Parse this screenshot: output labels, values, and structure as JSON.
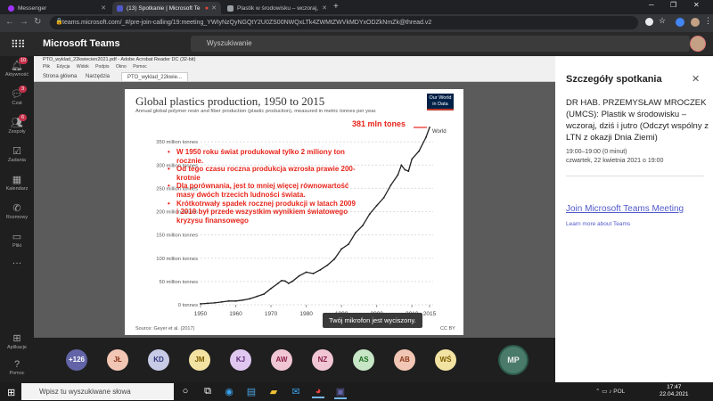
{
  "browser": {
    "tabs": [
      {
        "title": "Messenger",
        "icon": "messenger-icon",
        "color": "#a033ff"
      },
      {
        "title": "(13) Spotkanie | Microsoft Te",
        "icon": "teams-icon",
        "color": "#5059c9"
      },
      {
        "title": "Plastik w środowisku – wczoraj, dz",
        "icon": "web-icon",
        "color": "#9aa0a6"
      }
    ],
    "url": "teams.microsoft.com/_#/pre-join-calling/19:meeting_YWIyNzQyNGQtY2U0ZS00NWQxLTk4ZWMtZWVkMDYxODZkNmZk@thread.v2"
  },
  "teams": {
    "app_name": "Microsoft Teams",
    "search_placeholder": "Wyszukiwanie",
    "rail": [
      {
        "label": "Aktywność",
        "icon": "bell-icon",
        "badge": "10"
      },
      {
        "label": "Czat",
        "icon": "chat-icon",
        "badge": "3"
      },
      {
        "label": "Zespoły",
        "icon": "teams-group-icon",
        "badge": "6"
      },
      {
        "label": "Zadania",
        "icon": "tasks-icon",
        "badge": ""
      },
      {
        "label": "Kalendarz",
        "icon": "calendar-icon",
        "badge": ""
      },
      {
        "label": "Rozmowy",
        "icon": "phone-icon",
        "badge": ""
      },
      {
        "label": "Pliki",
        "icon": "files-icon",
        "badge": ""
      },
      {
        "label": "",
        "icon": "more-icon",
        "badge": ""
      }
    ],
    "rail_bottom": [
      {
        "label": "Aplikacje",
        "icon": "apps-icon"
      },
      {
        "label": "Pomoc",
        "icon": "help-icon"
      }
    ]
  },
  "acrobat": {
    "title": "PTO_wyklad_22kwiecien2021.pdf - Adobe Acrobat Reader DC (32-bit)",
    "menu": [
      "Plik",
      "Edycja",
      "Widok",
      "Podpis",
      "Okno",
      "Pomoc"
    ],
    "tabs": [
      "Strona główna",
      "Narzędzia",
      "PTO_wyklad_22kwie..."
    ]
  },
  "slide": {
    "title": "Global plastics production, 1950 to 2015",
    "subtitle": "Annual global polymer resin and fiber production (plastic production), measured in metric tonnes per year.",
    "logo": "Our World in Data",
    "source": "Source: Geyer et al. (2017)",
    "license": "CC BY",
    "highlight": "381 mln tones",
    "bullets": [
      "W 1950 roku świat produkował tylko 2 miliony ton rocznie.",
      "Od tego czasu roczna produkcja wzrosła prawie 200-krotnie",
      "Dla porównania, jest to mniej więcej równowartość masy dwóch trzecich ludności świata.",
      "Krótkotrwały spadek rocznej produkcji w latach 2009 i 2010 był przede wszystkim wynikiem światowego kryzysu finansowego"
    ],
    "mic_message": "Twój mikrofon jest wyciszony."
  },
  "chart_data": {
    "type": "line",
    "title": "Global plastics production, 1950 to 2015",
    "x": [
      1950,
      1952,
      1954,
      1956,
      1958,
      1960,
      1962,
      1964,
      1966,
      1968,
      1970,
      1972,
      1973,
      1974,
      1975,
      1976,
      1978,
      1980,
      1982,
      1984,
      1986,
      1988,
      1990,
      1992,
      1994,
      1996,
      1998,
      2000,
      2002,
      2004,
      2006,
      2007,
      2008,
      2009,
      2010,
      2012,
      2014,
      2015
    ],
    "series": [
      {
        "name": "World",
        "values": [
          2,
          3,
          4,
          6,
          8,
          8,
          10,
          13,
          18,
          23,
          35,
          46,
          52,
          51,
          46,
          50,
          62,
          70,
          67,
          75,
          85,
          98,
          120,
          130,
          155,
          170,
          195,
          213,
          230,
          257,
          279,
          300,
          290,
          287,
          313,
          330,
          360,
          381
        ]
      }
    ],
    "xticks": [
      "1950",
      "1960",
      "1970",
      "1980",
      "1990",
      "2000",
      "2010",
      "2015"
    ],
    "xtick_values": [
      1950,
      1960,
      1970,
      1980,
      1990,
      2000,
      2010,
      2015
    ],
    "yticks": [
      "0 tonnes",
      "50 million tonnes",
      "100 million tonnes",
      "150 million tonnes",
      "200 million tonnes",
      "250 million tonnes",
      "300 million tonnes",
      "350 million tonnes"
    ],
    "ytick_values": [
      0,
      50,
      100,
      150,
      200,
      250,
      300,
      350
    ],
    "xlim": [
      1950,
      2015
    ],
    "ylim": [
      0,
      381
    ],
    "grid": true,
    "series_label": "World"
  },
  "participants": [
    {
      "initials": "+126",
      "bg": "#6264a7",
      "fg": "#ffffff"
    },
    {
      "initials": "JŁ",
      "bg": "#f2c6b4",
      "fg": "#8a3b1e"
    },
    {
      "initials": "KD",
      "bg": "#c7cbe6",
      "fg": "#33347a"
    },
    {
      "initials": "JM",
      "bg": "#f3e3a3",
      "fg": "#7a5c00"
    },
    {
      "initials": "KJ",
      "bg": "#e0c7ef",
      "fg": "#5b2c7a"
    },
    {
      "initials": "AW",
      "bg": "#f0c6d4",
      "fg": "#8a1e47"
    },
    {
      "initials": "NZ",
      "bg": "#f0c6d4",
      "fg": "#8a1e47"
    },
    {
      "initials": "AS",
      "bg": "#c6e6c6",
      "fg": "#1e6a1e"
    },
    {
      "initials": "AB",
      "bg": "#f2c6b4",
      "fg": "#8a3b1e"
    },
    {
      "initials": "WŚ",
      "bg": "#f3e3a3",
      "fg": "#7a5c00"
    }
  ],
  "self": {
    "initials": "MP"
  },
  "details": {
    "heading": "Szczegóły spotkania",
    "title": "DR HAB. PRZEMYSŁAW MROCZEK (UMCS): Plastik w środowisku – wczoraj, dziś i jutro (Odczyt wspólny z LTN z okazji Dnia Ziemi)",
    "time": "19:00–19:00 (0 minut)",
    "date": "czwartek, 22 kwietnia 2021 o 19:00",
    "join": "Join Microsoft Teams Meeting",
    "learn": "Learn more about Teams"
  },
  "taskbar": {
    "search_placeholder": "Wpisz tu wyszukiwane słowa",
    "time": "17:47",
    "date": "22.04.2021",
    "tray_lang": "POL"
  }
}
